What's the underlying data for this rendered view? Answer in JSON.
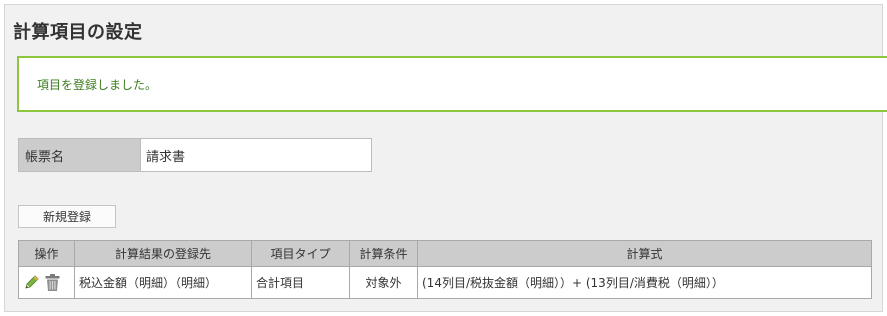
{
  "page": {
    "title": "計算項目の設定"
  },
  "notice": {
    "message": "項目を登録しました。"
  },
  "form": {
    "label": "帳票名",
    "value": "請求書"
  },
  "actions": {
    "new_label": "新規登録"
  },
  "table": {
    "headers": [
      "操作",
      "計算結果の登録先",
      "項目タイプ",
      "計算条件",
      "計算式"
    ],
    "rows": [
      {
        "target": "税込金額（明細）（明細）",
        "type": "合計項目",
        "condition": "対象外",
        "formula": "(14列目/税抜金額（明細））+ (13列目/消費税（明細））",
        "icons": [
          "pencil-icon",
          "trash-icon"
        ]
      }
    ]
  },
  "colors": {
    "success_border": "#8cc63f",
    "success_text": "#3a7d1e",
    "header_bg": "#cccccc",
    "panel_bg": "#f1f1f1"
  }
}
